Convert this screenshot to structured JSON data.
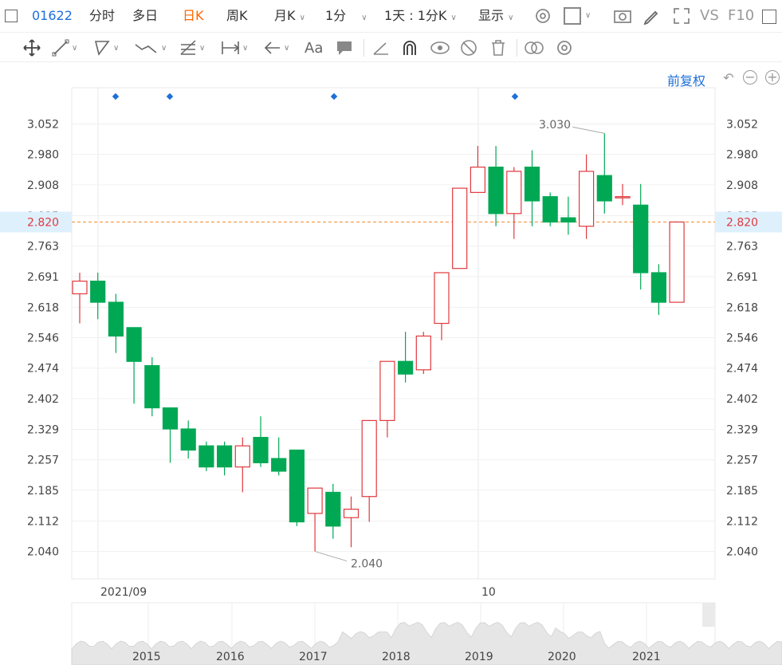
{
  "header": {
    "code": "01622",
    "tabs": [
      "分时",
      "多日",
      "日K",
      "周K",
      "月K",
      "1分"
    ],
    "active_tab": "日K",
    "period_select": "1天 : 1分K",
    "display_select": "显示",
    "vs_label": "VS",
    "f10_label": "F10"
  },
  "toolbar": {
    "text_tool": "Aa",
    "icons": [
      "move-icon",
      "line-icon",
      "polyline-icon",
      "wave-icon",
      "fib-icon",
      "measure-icon",
      "arrow-icon",
      "text-icon",
      "comment-icon",
      "ruler-icon",
      "magnet-icon",
      "eye-icon",
      "hide-icon",
      "trash-icon",
      "link-icon",
      "gear-icon"
    ]
  },
  "chart_controls": {
    "adjust_label": "前复权",
    "undo": "↶",
    "zoom_out": "−",
    "zoom_in": "+"
  },
  "colors": {
    "up": "#e0393e",
    "down": "#00a854",
    "accent": "#1e6fd9",
    "dashed": "#f08a2b",
    "price_highlight_bg": "#dff0fd"
  },
  "chart_data": {
    "type": "candlestick",
    "y_ticks": [
      "3.052",
      "2.980",
      "2.908",
      "2.835",
      "2.763",
      "2.691",
      "2.618",
      "2.546",
      "2.474",
      "2.402",
      "2.329",
      "2.257",
      "2.185",
      "2.112",
      "2.040"
    ],
    "y_range": [
      1.975,
      3.138
    ],
    "x_labels": [
      "2021/09",
      "10"
    ],
    "current_price": "2.820",
    "annotations": {
      "high": "3.030",
      "low": "2.040"
    },
    "candles": [
      {
        "o": 2.65,
        "h": 2.7,
        "l": 2.58,
        "c": 2.68
      },
      {
        "o": 2.68,
        "h": 2.7,
        "l": 2.59,
        "c": 2.63
      },
      {
        "o": 2.63,
        "h": 2.65,
        "l": 2.51,
        "c": 2.55
      },
      {
        "o": 2.57,
        "h": 2.57,
        "l": 2.39,
        "c": 2.49
      },
      {
        "o": 2.48,
        "h": 2.5,
        "l": 2.36,
        "c": 2.38
      },
      {
        "o": 2.38,
        "h": 2.36,
        "l": 2.25,
        "c": 2.33
      },
      {
        "o": 2.33,
        "h": 2.35,
        "l": 2.26,
        "c": 2.28
      },
      {
        "o": 2.29,
        "h": 2.3,
        "l": 2.23,
        "c": 2.24
      },
      {
        "o": 2.29,
        "h": 2.3,
        "l": 2.22,
        "c": 2.24
      },
      {
        "o": 2.24,
        "h": 2.31,
        "l": 2.18,
        "c": 2.29
      },
      {
        "o": 2.31,
        "h": 2.36,
        "l": 2.24,
        "c": 2.25
      },
      {
        "o": 2.26,
        "h": 2.31,
        "l": 2.22,
        "c": 2.23
      },
      {
        "o": 2.28,
        "h": 2.28,
        "l": 2.1,
        "c": 2.11
      },
      {
        "o": 2.13,
        "h": 2.19,
        "l": 2.04,
        "c": 2.19
      },
      {
        "o": 2.18,
        "h": 2.2,
        "l": 2.07,
        "c": 2.1
      },
      {
        "o": 2.12,
        "h": 2.17,
        "l": 2.05,
        "c": 2.14
      },
      {
        "o": 2.17,
        "h": 2.35,
        "l": 2.11,
        "c": 2.35
      },
      {
        "o": 2.35,
        "h": 2.49,
        "l": 2.31,
        "c": 2.49
      },
      {
        "o": 2.49,
        "h": 2.56,
        "l": 2.44,
        "c": 2.46
      },
      {
        "o": 2.47,
        "h": 2.56,
        "l": 2.46,
        "c": 2.55
      },
      {
        "o": 2.58,
        "h": 2.7,
        "l": 2.54,
        "c": 2.7
      },
      {
        "o": 2.71,
        "h": 2.9,
        "l": 2.71,
        "c": 2.9
      },
      {
        "o": 2.89,
        "h": 3.0,
        "l": 2.89,
        "c": 2.95
      },
      {
        "o": 2.95,
        "h": 3.0,
        "l": 2.81,
        "c": 2.84
      },
      {
        "o": 2.84,
        "h": 2.95,
        "l": 2.78,
        "c": 2.94
      },
      {
        "o": 2.95,
        "h": 2.99,
        "l": 2.81,
        "c": 2.87
      },
      {
        "o": 2.88,
        "h": 2.89,
        "l": 2.81,
        "c": 2.82
      },
      {
        "o": 2.83,
        "h": 2.88,
        "l": 2.79,
        "c": 2.82
      },
      {
        "o": 2.81,
        "h": 2.98,
        "l": 2.78,
        "c": 2.94
      },
      {
        "o": 2.93,
        "h": 3.03,
        "l": 2.84,
        "c": 2.87
      },
      {
        "o": 2.88,
        "h": 2.91,
        "l": 2.86,
        "c": 2.88
      },
      {
        "o": 2.86,
        "h": 2.91,
        "l": 2.66,
        "c": 2.7
      },
      {
        "o": 2.7,
        "h": 2.72,
        "l": 2.6,
        "c": 2.63
      },
      {
        "o": 2.63,
        "h": 2.82,
        "l": 2.63,
        "c": 2.82
      }
    ],
    "navigator_years": [
      "2015",
      "2016",
      "2017",
      "2018",
      "2019",
      "2020",
      "2021"
    ]
  }
}
